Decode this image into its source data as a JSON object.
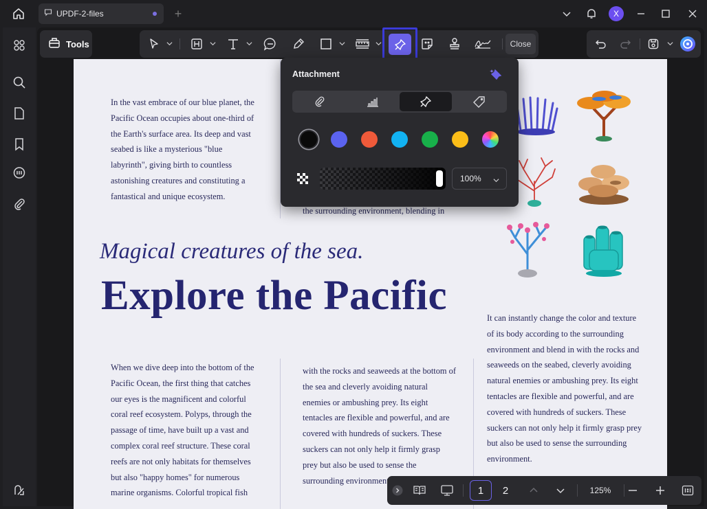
{
  "window": {
    "tab_title": "UPDF-2-files",
    "avatar_letter": "X"
  },
  "toolbar": {
    "tools_label": "Tools",
    "close_label": "Close"
  },
  "attachment_popup": {
    "title": "Attachment",
    "icon_types": [
      "paperclip-icon",
      "graph-icon",
      "pushpin-icon",
      "tag-icon"
    ],
    "selected_icon_type": "pushpin-icon",
    "colors": [
      "#0a0a0a",
      "#5b63ef",
      "#ef5a3a",
      "#12b2f2",
      "#18b04a",
      "#fbbd18",
      "rainbow"
    ],
    "selected_color": "#0a0a0a",
    "opacity_value": "100%",
    "opacity_fraction": 1.0
  },
  "document": {
    "intro_paragraph": "In the vast embrace of our blue planet, the Pacific Ocean occupies about one-third of the Earth's surface area. Its deep and vast seabed is like a mysterious \"blue labyrinth\", giving birth to countless astonishing creatures and constituting a fantastical and unique ecosystem.",
    "partial_line": "the surrounding environment, blending in",
    "subtitle": "Magical creatures of the sea.",
    "headline": "Explore the Pacific",
    "col1": "When we dive deep into the bottom of the Pacific Ocean, the first thing that catches our eyes is the magnificent and colorful coral reef ecosystem. Polyps, through the passage of time, have built up a vast and complex coral reef structure. These coral reefs are not only habitats for themselves but also \"happy homes\" for numerous marine organisms. Colorful tropical fish",
    "col2": "with the rocks and seaweeds at the bottom of the sea and cleverly avoiding natural enemies or ambushing prey. Its eight tentacles are flexible and powerful, and are covered with hundreds of suckers. These suckers can not only help it firmly grasp prey but also be used to sense the surrounding environment.",
    "col3": "It can instantly change the color and texture of its body according to the surrounding environment and blend in with the rocks and seaweeds on the seabed, cleverly avoiding natural enemies or ambushing prey. Its eight tentacles are flexible and powerful, and are covered with hundreds of suckers. These suckers can not only help it firmly grasp prey but also be used to sense the surrounding environment."
  },
  "bottom_bar": {
    "pages": [
      "1",
      "2"
    ],
    "current_page": "1",
    "zoom": "125%"
  }
}
